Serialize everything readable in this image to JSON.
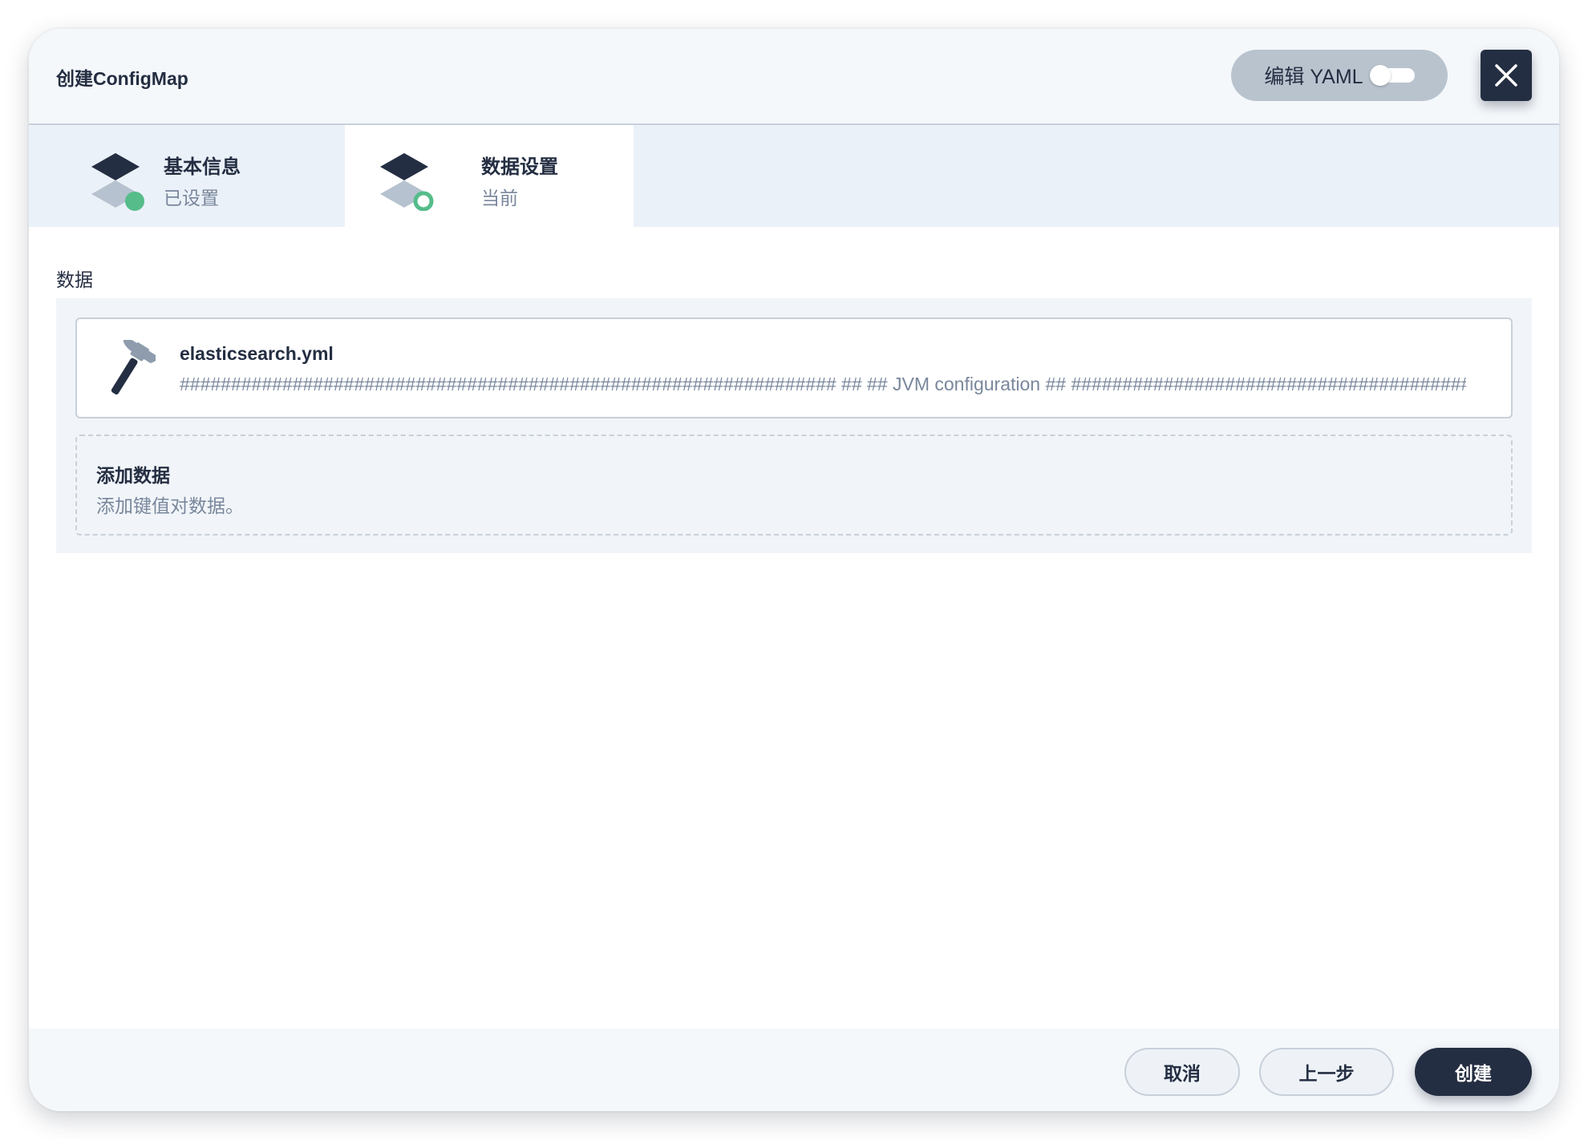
{
  "header": {
    "title": "创建ConfigMap",
    "yaml_toggle_label": "编辑 YAML",
    "yaml_toggle_on": false,
    "close_icon": "close-icon"
  },
  "steps": [
    {
      "title": "基本信息",
      "status": "已设置",
      "icon": "layers-icon",
      "state": "done"
    },
    {
      "title": "数据设置",
      "status": "当前",
      "icon": "layers-icon",
      "state": "current"
    }
  ],
  "data_section": {
    "label": "数据",
    "items": [
      {
        "key": "elasticsearch.yml",
        "value": "################################################################ ## ## JVM configuration ## ################################################################",
        "icon": "hammer-icon"
      }
    ],
    "add": {
      "title": "添加数据",
      "description": "添加键值对数据。"
    }
  },
  "footer": {
    "cancel_label": "取消",
    "prev_label": "上一步",
    "create_label": "创建"
  },
  "colors": {
    "primary_dark": "#242e42",
    "success_green": "#55bc8a",
    "muted_text": "#79879c",
    "border": "#c8d0da",
    "step_bar_bg": "#ebf1f8",
    "toggle_bg": "#b9c3ce"
  }
}
